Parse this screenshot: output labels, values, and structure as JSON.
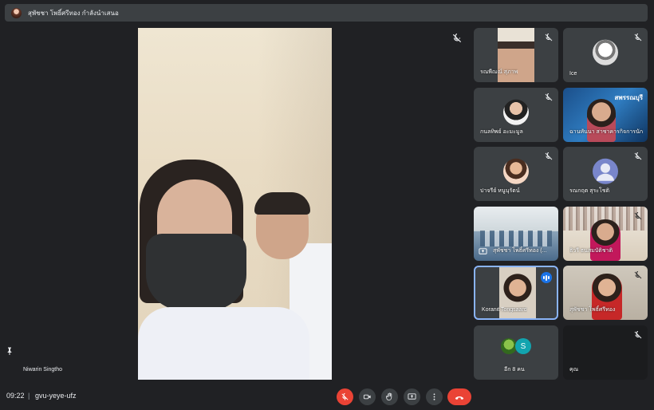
{
  "presenter_bar": {
    "title": "สุพัชชา โพธิ์ศรีทอง กำลังนำเสนอ"
  },
  "main_stage": {
    "pinned_name": "Niwarin Singtho"
  },
  "participants": [
    {
      "name": "รณพีณณ์ สุภาพ",
      "muted": true
    },
    {
      "name": "Ice",
      "muted": true
    },
    {
      "name": "กนลทิพย์ อะมะมูล",
      "muted": true
    },
    {
      "name": "ฉานหันนา สาชาคารกิจการนักศึกษา",
      "muted": false,
      "overlay_text": "สพรรณบุรี"
    },
    {
      "name": "ปาจรีย์ หนูนุรัตน์",
      "muted": true
    },
    {
      "name": "รณกฤต สุระโชติ",
      "muted": true
    },
    {
      "name": "สุพัชชา โพธิ์ศรีทอง (...",
      "muted": false,
      "presenting": true
    },
    {
      "name": "ธิวรี ธนสมบัติชาติ",
      "muted": true
    },
    {
      "name": "Koranit Tongsaard",
      "muted": false,
      "speaking": true
    },
    {
      "name": "สุพัชชา โพธิ์ศรีทอง",
      "muted": true
    },
    {
      "name": "อีก 8 คน",
      "muted": false,
      "avatar_letter": "S"
    },
    {
      "name": "คุณ",
      "muted": true
    }
  ],
  "meeting": {
    "time": "09:22",
    "separator": "|",
    "code": "gvu-yeye-ufz"
  },
  "colors": {
    "background": "#202124",
    "tile": "#3c4043",
    "accent": "#8ab4f8",
    "danger": "#ea4335",
    "speaking": "#1a73e8"
  },
  "controls": [
    {
      "name": "microphone-off",
      "icon": "mic-off-icon"
    },
    {
      "name": "camera",
      "icon": "camera-icon"
    },
    {
      "name": "raise-hand",
      "icon": "hand-icon"
    },
    {
      "name": "present",
      "icon": "present-icon"
    },
    {
      "name": "more-options",
      "icon": "more-vert-icon"
    },
    {
      "name": "leave-call",
      "icon": "hangup-icon"
    }
  ]
}
